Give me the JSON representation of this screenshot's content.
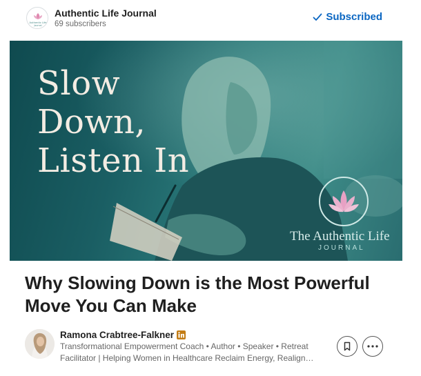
{
  "publication": {
    "name": "Authentic Life Journal",
    "subscribers": "69 subscribers",
    "logo_text": "Authentic Life Journal",
    "subscribed_label": "Subscribed",
    "subscribed_color": "#0a66c2"
  },
  "cover": {
    "headline": "Slow\nDown,\nListen In",
    "brand_line1": "The Authentic Life",
    "brand_line2": "JOURNAL",
    "lotus_color": "#e7a1c4"
  },
  "article": {
    "title": "Why Slowing Down is the Most Powerful Move You Can Make"
  },
  "author": {
    "name": "Ramona Crabtree-Falkner",
    "badge_icon": "linkedin-premium-icon",
    "bio_line1": "Transformational Empowerment Coach • Author • Speaker • Retreat",
    "bio_line2": "Facilitator | Helping Women in Healthcare Reclaim Energy, Realign…"
  },
  "actions": {
    "save_icon": "bookmark-icon",
    "more_icon": "more-icon"
  }
}
